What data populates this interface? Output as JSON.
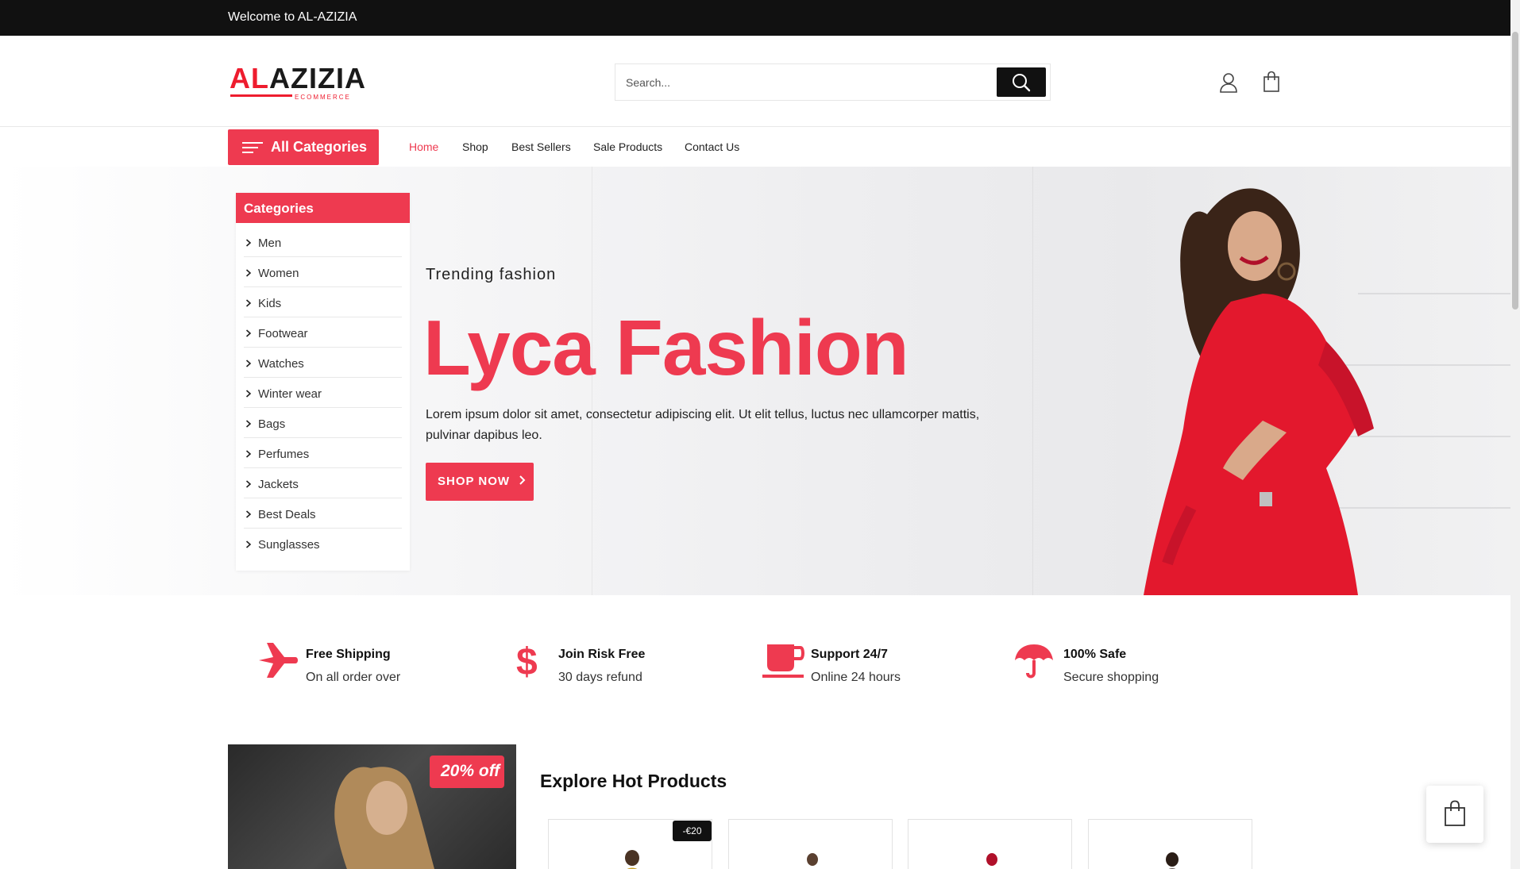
{
  "topbar": {
    "welcome": "Welcome to AL-AZIZIA"
  },
  "logo": {
    "prefix": "AL",
    "rest": "AZIZIA",
    "tagline": "ECOMMERCE"
  },
  "search": {
    "placeholder": "Search..."
  },
  "nav": {
    "all_categories": "All Categories",
    "links": [
      "Home",
      "Shop",
      "Best Sellers",
      "Sale Products",
      "Contact Us"
    ],
    "active": "Home"
  },
  "categories": {
    "title": "Categories",
    "items": [
      "Men",
      "Women",
      "Kids",
      "Footwear",
      "Watches",
      "Winter wear",
      "Bags",
      "Perfumes",
      "Jackets",
      "Best Deals",
      "Sunglasses"
    ]
  },
  "hero": {
    "subtitle": "Trending fashion",
    "title": "Lyca Fashion",
    "text": "Lorem ipsum dolor sit amet, consectetur adipiscing elit. Ut elit tellus, luctus nec ullamcorper mattis, pulvinar dapibus leo.",
    "cta": "SHOP NOW"
  },
  "features": [
    {
      "icon": "airplane-icon",
      "title": "Free Shipping",
      "subtitle": "On all order over"
    },
    {
      "icon": "dollar-icon",
      "title": "Join Risk Free",
      "subtitle": "30 days refund"
    },
    {
      "icon": "coffee-cup-icon",
      "title": "Support 24/7",
      "subtitle": "Online 24 hours"
    },
    {
      "icon": "umbrella-icon",
      "title": "100% Safe",
      "subtitle": "Secure shopping"
    }
  ],
  "promo": {
    "badge": "20% off"
  },
  "products": {
    "title": "Explore Hot Products",
    "discount_badge": "-€20",
    "count": 4
  },
  "colors": {
    "accent": "#ee3a50",
    "dark": "#111111"
  }
}
